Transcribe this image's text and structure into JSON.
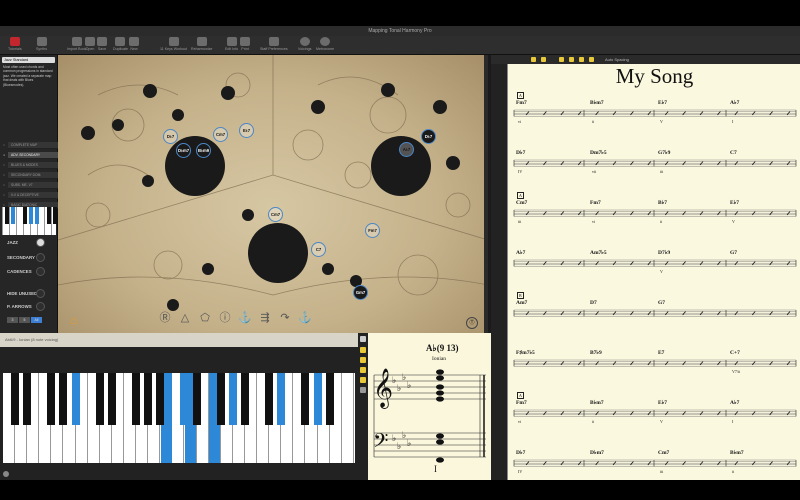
{
  "app": {
    "window_title": "Mapping Tonal Harmony Pro"
  },
  "toolbar": {
    "items": [
      {
        "label": "Tutorials",
        "icon": "tutorials-icon"
      },
      {
        "label": "Synths",
        "icon": "synths-icon"
      },
      {
        "label": "Import Book",
        "icon": "import-book-icon"
      },
      {
        "label": "Open",
        "icon": "open-icon"
      },
      {
        "label": "Save",
        "icon": "save-icon"
      },
      {
        "label": "Duplicate",
        "icon": "duplicate-icon"
      },
      {
        "label": "New",
        "icon": "new-icon"
      },
      {
        "label": "11 Keys Workout",
        "icon": "keys-workout-icon"
      },
      {
        "label": "Reharmonize",
        "icon": "reharmonize-icon"
      },
      {
        "label": "Edit Info",
        "icon": "edit-info-icon"
      },
      {
        "label": "Print",
        "icon": "print-icon"
      },
      {
        "label": "Staff Preferences",
        "icon": "staff-preferences-icon"
      },
      {
        "label": "Voicings",
        "icon": "voicings-icon"
      },
      {
        "label": "Metronome",
        "icon": "metronome-icon"
      }
    ]
  },
  "sidebar": {
    "selected_preset": "Jazz Standard",
    "description": "Most often used chords and common progressions in standard jazz. We created a separate map that deals with Blues (Bluesmodes).",
    "maps": [
      {
        "label": "COMPLETE MAP"
      },
      {
        "label": "ADV. SECONDARY"
      },
      {
        "label": "BLUES & MODES"
      },
      {
        "label": "SECONDARY DOM."
      },
      {
        "label": "SUBS. ME. V7"
      },
      {
        "label": "II-V & DECEPTIVE"
      },
      {
        "label": "BASIC DIATONIC"
      }
    ],
    "options": {
      "jazz": "JAZZ",
      "secondary": "SECONDARY",
      "cadences": "CADENCES",
      "hide_unused": "HIDE UNUSED",
      "p_arrows": "P. ARROWS"
    },
    "segments": [
      "3",
      "5",
      "All"
    ]
  },
  "map": {
    "chords": [
      {
        "label": "D♭7"
      },
      {
        "label": "D♭m7"
      },
      {
        "label": "B♭m9"
      },
      {
        "label": "Cm7"
      },
      {
        "label": "E♭7"
      },
      {
        "label": "D♭7"
      },
      {
        "label": "A♭7"
      },
      {
        "label": "Cm7"
      },
      {
        "label": "Fm7"
      },
      {
        "label": "C7"
      },
      {
        "label": "Gm7"
      }
    ]
  },
  "piano": {
    "header": "Ab6/9 - Ionian (8 note voicing)"
  },
  "notation": {
    "chord": "A♭(9 13)",
    "mode": "Ionian",
    "roman": "I"
  },
  "leadsheet": {
    "auto_spacing_label": "Auto Spacing",
    "title": "My Song",
    "rows": [
      {
        "section": "A",
        "chords": [
          "Fm7",
          "B♭m7",
          "E♭7",
          "A♭7"
        ],
        "romans": [
          "vi",
          "ii",
          "V",
          "I"
        ]
      },
      {
        "section": "",
        "chords": [
          "D♭7",
          "Dm7♭5",
          "G7♭9",
          "C7"
        ],
        "romans": [
          "IV",
          "vii",
          "iii",
          ""
        ]
      },
      {
        "section": "A",
        "chords": [
          "Cm7",
          "Fm7",
          "B♭7",
          "E♭7"
        ],
        "romans": [
          "iii",
          "vi",
          "ii",
          "V"
        ]
      },
      {
        "section": "",
        "chords": [
          "A♭7",
          "Am7♭5",
          "D7♭9",
          "G7"
        ],
        "romans": [
          "",
          "",
          "V",
          ""
        ]
      },
      {
        "section": "B",
        "chords": [
          "Am7",
          "D7",
          "G7"
        ],
        "romans": [
          "",
          "",
          ""
        ]
      },
      {
        "section": "",
        "chords": [
          "F♯m7♭5",
          "B7♭9",
          "E7",
          "C+7"
        ],
        "romans": [
          "",
          "",
          "",
          "V7/ii"
        ]
      },
      {
        "section": "A",
        "chords": [
          "Fm7",
          "B♭m7",
          "E♭7",
          "A♭7"
        ],
        "romans": [
          "vi",
          "ii",
          "V",
          "I"
        ]
      },
      {
        "section": "",
        "chords": [
          "D♭7",
          "D♭m7",
          "Cm7",
          "B♭m7"
        ],
        "romans": [
          "IV",
          "",
          "iii",
          "ii"
        ]
      }
    ]
  }
}
